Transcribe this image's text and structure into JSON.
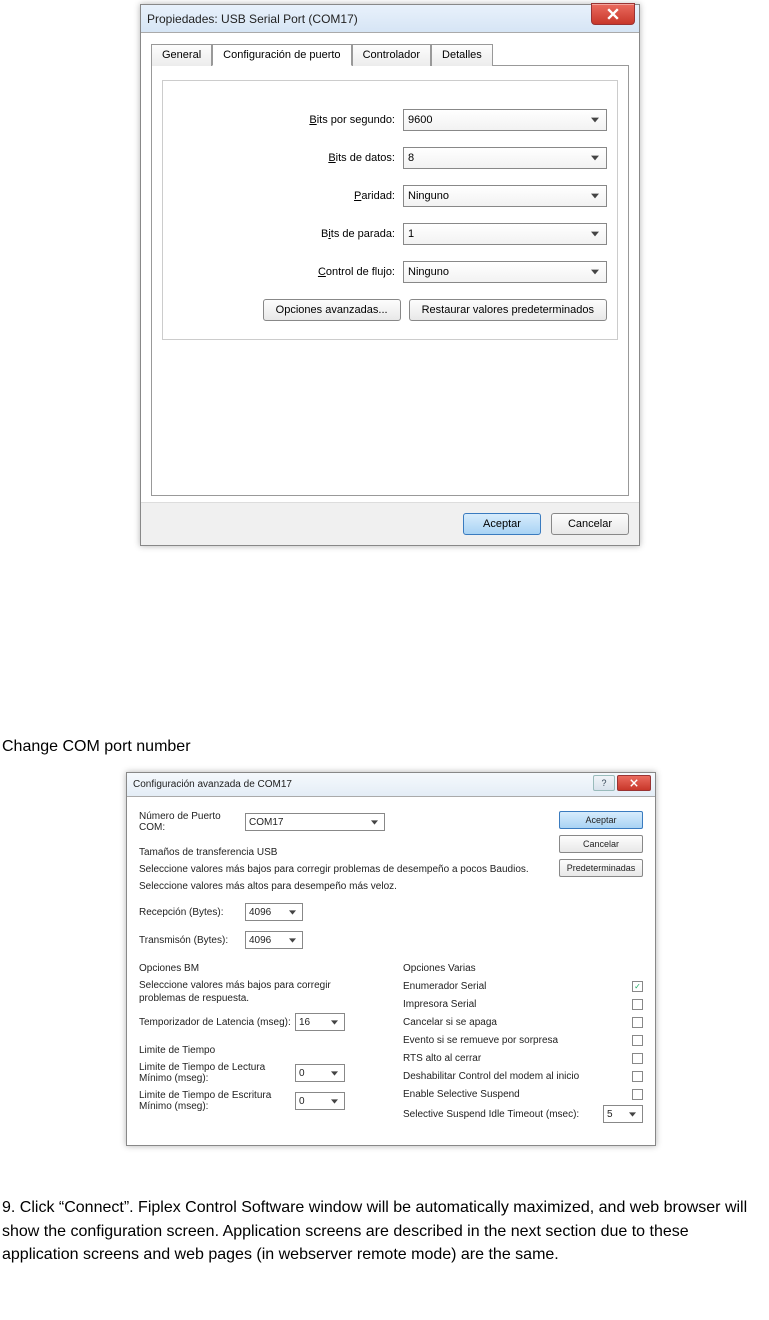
{
  "dialog1": {
    "title": "Propiedades: USB Serial Port (COM17)",
    "tabs": [
      "General",
      "Configuración de puerto",
      "Controlador",
      "Detalles"
    ],
    "fields": [
      {
        "label_pre": "",
        "label_u": "B",
        "label_post": "its por segundo:",
        "value": "9600"
      },
      {
        "label_pre": "",
        "label_u": "B",
        "label_post": "its de datos:",
        "value": "8"
      },
      {
        "label_pre": "",
        "label_u": "P",
        "label_post": "aridad:",
        "value": "Ninguno"
      },
      {
        "label_pre": "B",
        "label_u": "i",
        "label_post": "ts de parada:",
        "value": "1"
      },
      {
        "label_pre": "",
        "label_u": "C",
        "label_post": "ontrol de flujo:",
        "value": "Ninguno"
      }
    ],
    "advanced_btn": "Opciones avanzadas...",
    "restore_btn": "Restaurar valores predeterminados",
    "ok": "Aceptar",
    "cancel": "Cancelar"
  },
  "heading1": "Change COM port number",
  "dialog2": {
    "title": "Configuración avanzada de COM17",
    "port_label": "Número de Puerto COM:",
    "port_value": "COM17",
    "btns": {
      "ok": "Aceptar",
      "cancel": "Cancelar",
      "defaults": "Predeterminadas"
    },
    "usb_title": "Tamaños de transferencia USB",
    "usb_desc1": "Seleccione valores más bajos para corregir problemas de desempeño a pocos Baudios.",
    "usb_desc2": "Seleccione valores más altos para desempeño más veloz.",
    "rx_label": "Recepción (Bytes):",
    "rx_value": "4096",
    "tx_label": "Transmisón (Bytes):",
    "tx_value": "4096",
    "bm_title": "Opciones BM",
    "bm_desc": "Seleccione valores más bajos para corregir problemas de respuesta.",
    "lat_label": "Temporizador de Latencia (mseg):",
    "lat_value": "16",
    "to_title": "Limite de Tiempo",
    "read_to_label": "Limite de Tiempo de Lectura Mínimo (mseg):",
    "read_to_value": "0",
    "write_to_label": "Limite de Tiempo de Escritura Mínimo (mseg):",
    "write_to_value": "0",
    "misc_title": "Opciones Varias",
    "misc": [
      {
        "label": "Enumerador Serial",
        "checked": true
      },
      {
        "label": "Impresora Serial",
        "checked": false
      },
      {
        "label": "Cancelar si se apaga",
        "checked": false
      },
      {
        "label": "Evento si se remueve por sorpresa",
        "checked": false
      },
      {
        "label": "RTS alto al cerrar",
        "checked": false
      },
      {
        "label": "Deshabilitar Control del modem al inicio",
        "checked": false
      },
      {
        "label": "Enable Selective Suspend",
        "checked": false
      }
    ],
    "idle_label": "Selective Suspend Idle Timeout (msec):",
    "idle_value": "5"
  },
  "para": "9. Click “Connect”. Fiplex Control Software window will be automatically maximized, and web browser will show the configuration screen. Application screens are described in the next section due to these application screens and web pages (in webserver remote mode) are the same."
}
